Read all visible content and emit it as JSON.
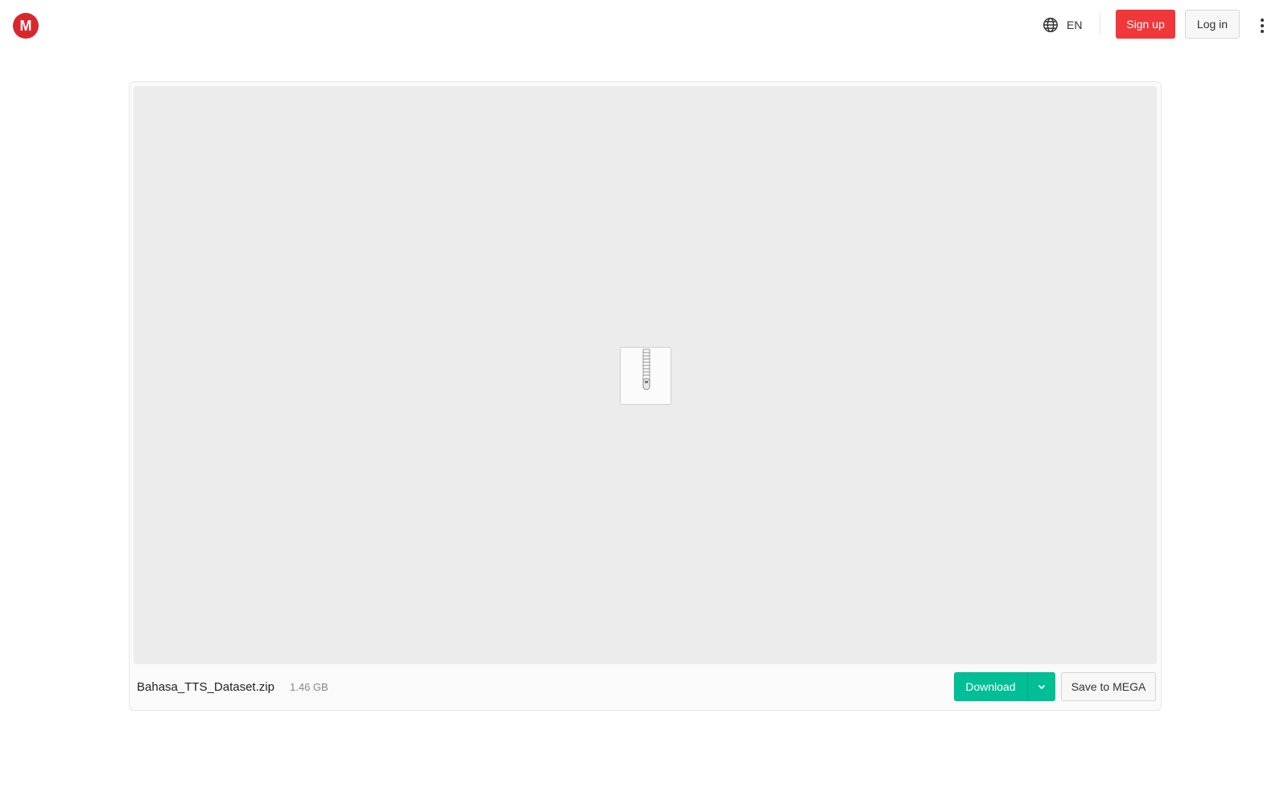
{
  "header": {
    "logo_letter": "M",
    "logo_color": "#d9272e",
    "language_code": "EN",
    "signup_label": "Sign up",
    "signup_color": "#f0373a",
    "login_label": "Log in"
  },
  "file": {
    "name": "Bahasa_TTS_Dataset.zip",
    "size": "1.46 GB",
    "preview_icon": "zip-archive-icon"
  },
  "actions": {
    "download_label": "Download",
    "download_color": "#00be96",
    "save_label": "Save to MEGA"
  },
  "icons": {
    "language": "globe-icon",
    "more": "kebab-menu-icon",
    "dropdown": "chevron-down-icon"
  }
}
